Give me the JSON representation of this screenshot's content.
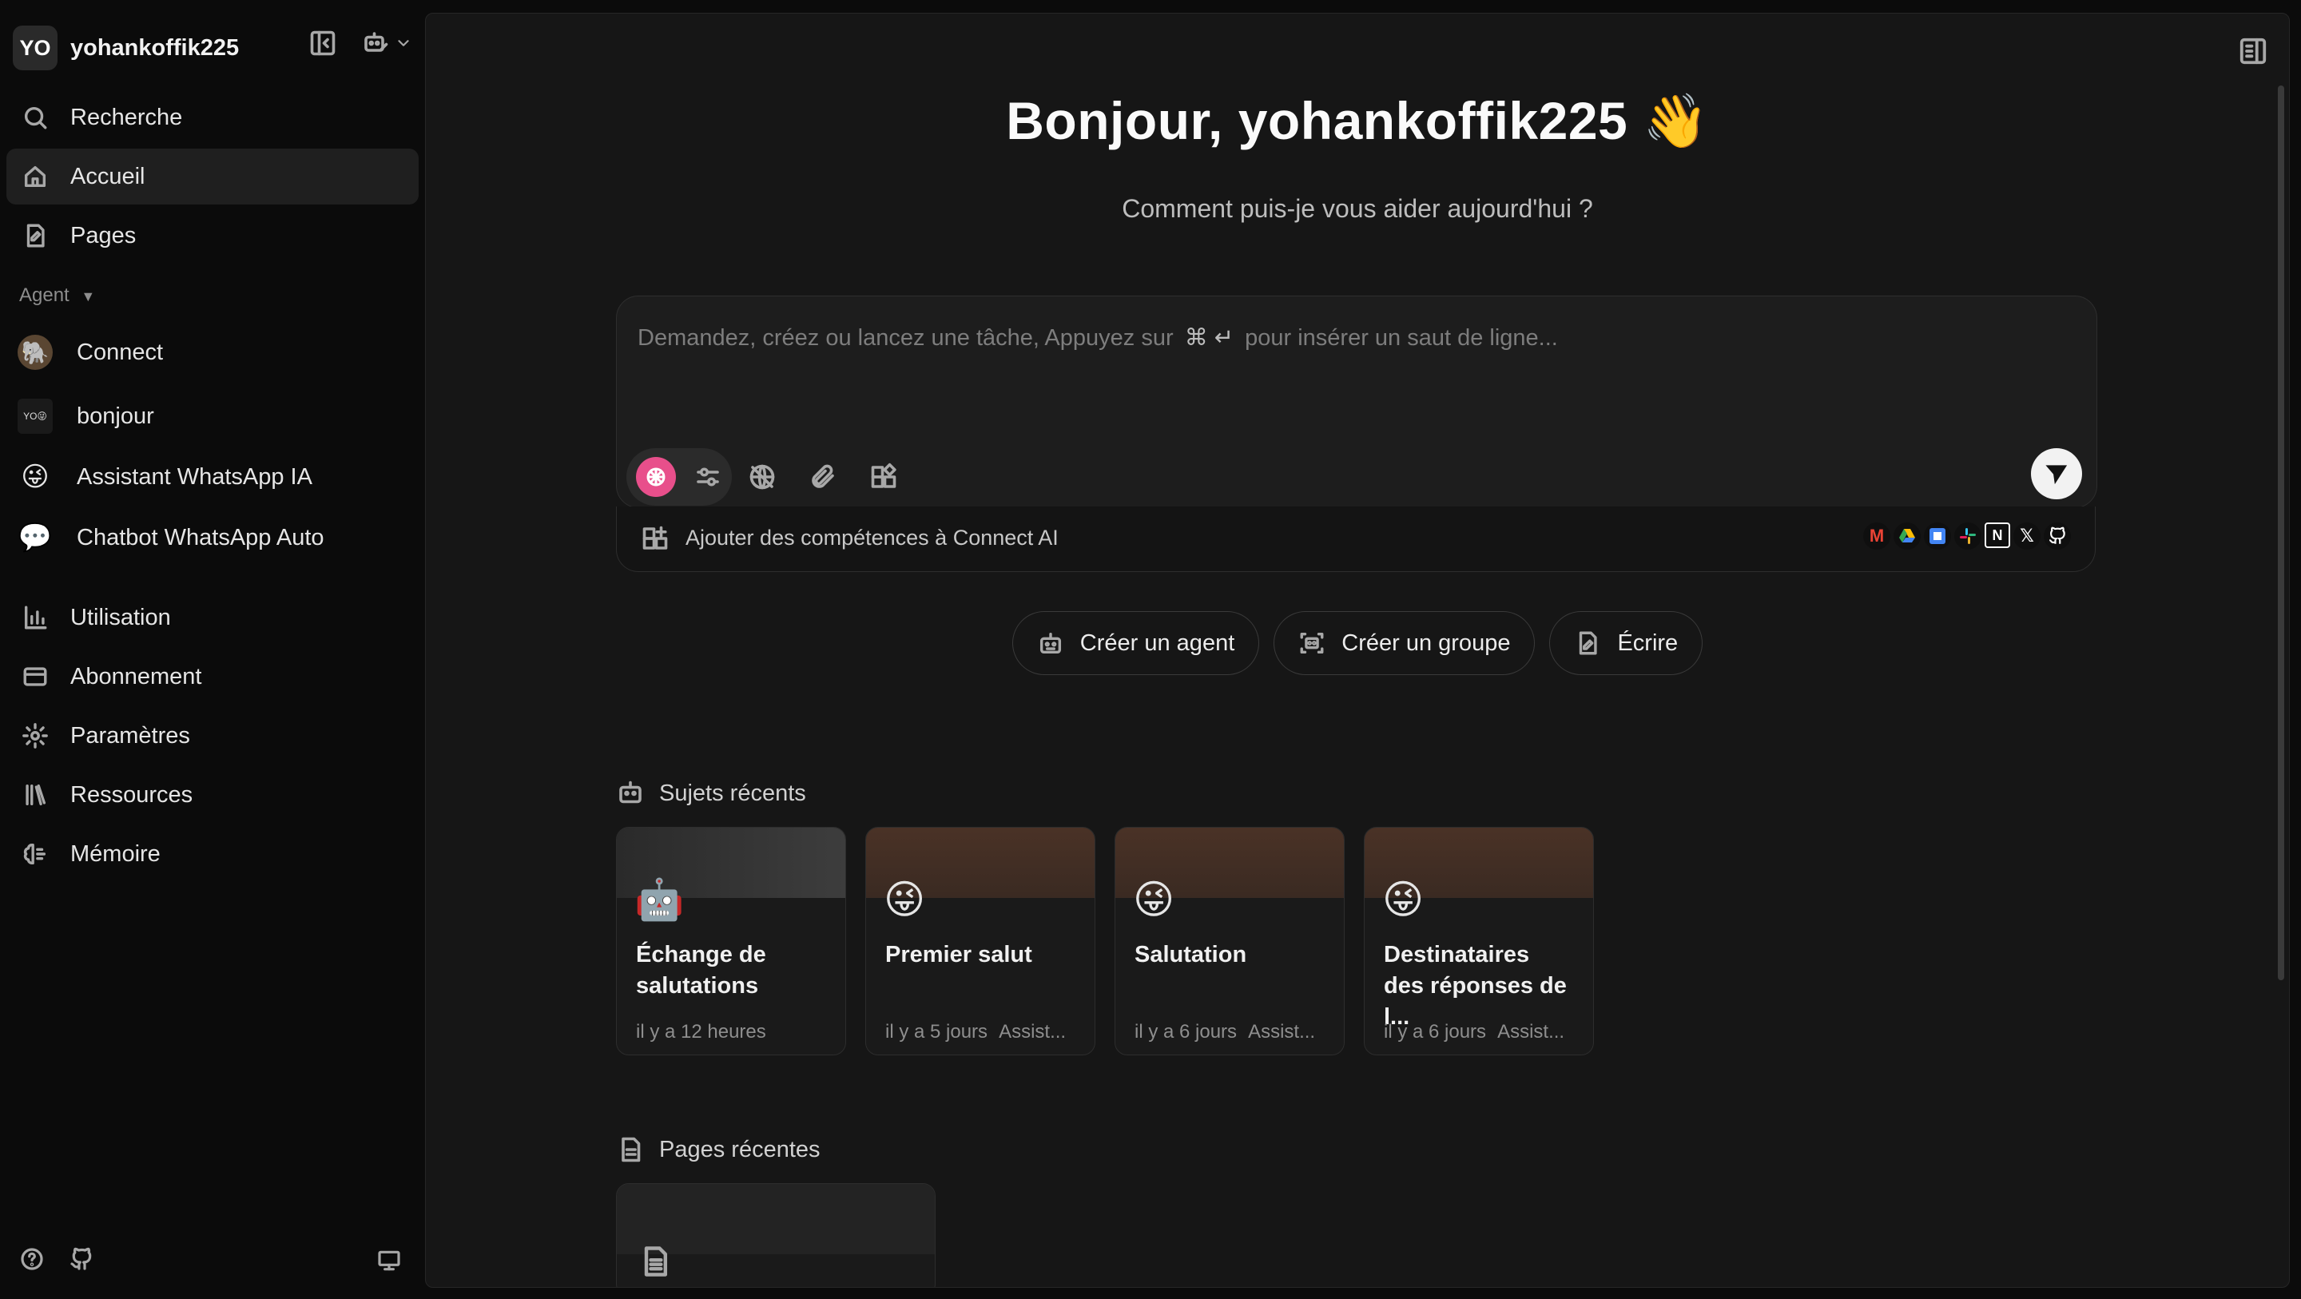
{
  "sidebar": {
    "user": {
      "initials": "YO",
      "name": "yohankoffik225"
    },
    "nav_top": [
      {
        "label": "Recherche",
        "icon": "search-icon"
      },
      {
        "label": "Accueil",
        "icon": "home-icon",
        "active": true
      },
      {
        "label": "Pages",
        "icon": "pages-icon"
      }
    ],
    "agent_section_label": "Agent",
    "agents": [
      {
        "label": "Connect",
        "icon": "elephant-avatar"
      },
      {
        "label": "bonjour",
        "icon": "yo-avatar"
      },
      {
        "label": "Assistant WhatsApp IA",
        "icon": "winking-face-emoji"
      },
      {
        "label": "Chatbot WhatsApp Auto",
        "icon": "speech-bubble-emoji"
      }
    ],
    "nav_bottom": [
      {
        "label": "Utilisation",
        "icon": "bar-chart-icon"
      },
      {
        "label": "Abonnement",
        "icon": "credit-card-icon"
      },
      {
        "label": "Paramètres",
        "icon": "gear-icon"
      },
      {
        "label": "Ressources",
        "icon": "library-icon"
      },
      {
        "label": "Mémoire",
        "icon": "brain-icon"
      }
    ]
  },
  "main": {
    "greeting": "Bonjour, yohankoffik225 👋",
    "subtitle": "Comment puis-je vous aider aujourd'hui ?",
    "composer": {
      "placeholder_before": "Demandez, créez ou lancez une tâche, Appuyez sur",
      "shortcut": "⌘ ↵",
      "placeholder_after": "pour insérer un saut de ligne..."
    },
    "skills_label": "Ajouter des compétences à Connect AI",
    "integrations": [
      "gmail",
      "google-drive",
      "google-calendar",
      "slack",
      "notion",
      "x",
      "github"
    ],
    "actions": [
      {
        "label": "Créer un agent",
        "icon": "robot-icon"
      },
      {
        "label": "Créer un groupe",
        "icon": "group-icon"
      },
      {
        "label": "Écrire",
        "icon": "write-icon"
      }
    ],
    "recent_topics_label": "Sujets récents",
    "recent_topics": [
      {
        "title": "Échange de salutations",
        "time": "il y a 12 heures",
        "agent": "",
        "emoji": "🤖"
      },
      {
        "title": "Premier salut",
        "time": "il y a 5 jours",
        "agent": "Assist...",
        "emoji": "😜"
      },
      {
        "title": "Salutation",
        "time": "il y a 6 jours",
        "agent": "Assist...",
        "emoji": "😜"
      },
      {
        "title": "Destinataires des réponses de l...",
        "time": "il y a 6 jours",
        "agent": "Assist...",
        "emoji": "😜"
      }
    ],
    "recent_pages_label": "Pages récentes"
  },
  "colors": {
    "background": "#0b0b0b",
    "panel": "#161616",
    "active_nav": "#1f1f1f",
    "model_logo": "#e84f8b"
  }
}
